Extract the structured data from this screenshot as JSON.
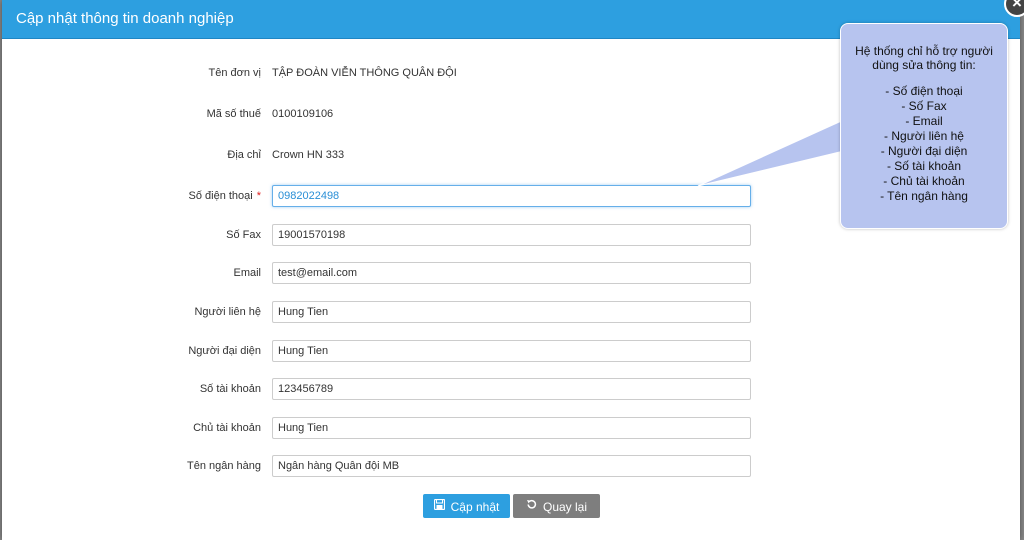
{
  "dialog": {
    "title": "Cập nhật thông tin doanh nghiệp",
    "close_symbol": "×",
    "close_icon": "close-icon"
  },
  "fields": {
    "company_name": {
      "label": "Tên đơn vị",
      "value": "TẬP ĐOÀN VIỄN THÔNG QUÂN ĐỘI"
    },
    "tax_code": {
      "label": "Mã số thuế",
      "value": "0100109106"
    },
    "address": {
      "label": "Địa chỉ",
      "value": "Crown HN 333"
    },
    "phone": {
      "label": "Số điện thoại",
      "required_mark": "*",
      "value": "0982022498",
      "focused": true
    },
    "fax": {
      "label": "Số Fax",
      "value": "19001570198"
    },
    "email": {
      "label": "Email",
      "value": "test@email.com"
    },
    "contact_person": {
      "label": "Người liên hệ",
      "value": "Hung Tien"
    },
    "representative": {
      "label": "Người đại diện",
      "value": "Hung Tien"
    },
    "account_number": {
      "label": "Số tài khoản",
      "value": "123456789"
    },
    "account_holder": {
      "label": "Chủ tài khoản",
      "value": "Hung Tien"
    },
    "bank_name": {
      "label": "Tên ngân hàng",
      "value": "Ngân hàng Quân đội MB"
    }
  },
  "buttons": {
    "update": {
      "label": "Cập nhật",
      "icon": "save-icon"
    },
    "back": {
      "label": "Quay lại",
      "icon": "undo-icon"
    }
  },
  "tooltip": {
    "intro": "Hệ thống chỉ hỗ trợ người dùng sửa thông tin:",
    "items": [
      "- Số điện thoại",
      "- Số Fax",
      "- Email",
      "- Người liên hệ",
      "- Người đại diện",
      "- Số tài khoản",
      "- Chủ tài khoản",
      "- Tên ngân hàng"
    ]
  },
  "colors": {
    "header": "#2d9fe0",
    "update_button": "#2d9fe0",
    "back_button": "#7e7e7e",
    "tooltip_bg": "#b7c4ef",
    "required_mark": "#e02020",
    "focused_text": "#2a8fd6"
  }
}
